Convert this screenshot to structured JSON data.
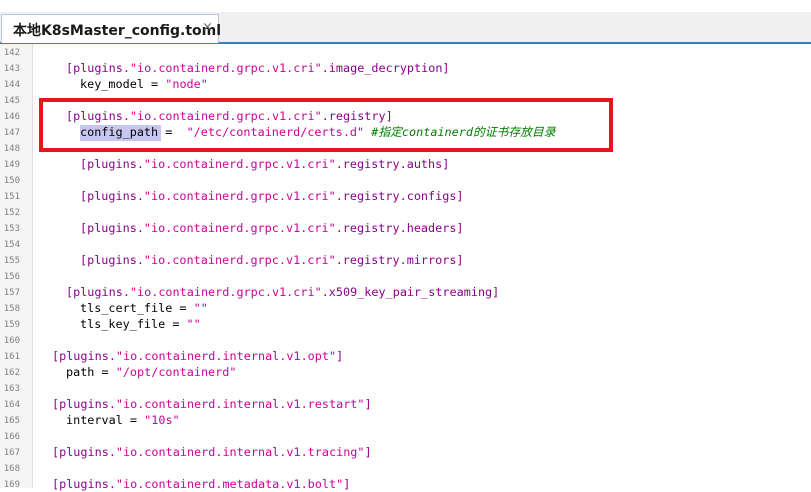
{
  "tab": {
    "title": "本地K8sMaster_config.toml",
    "close": "×"
  },
  "lines": [
    {
      "n": "142",
      "key": "",
      "section": [],
      "tail": ""
    },
    {
      "n": "143",
      "section": [
        "[plugins.",
        "\"io.containerd.grpc.v1.cri\"",
        ".image_decryption]"
      ]
    },
    {
      "n": "144",
      "kv": [
        "key_model = ",
        "\"node\""
      ]
    },
    {
      "n": "145"
    },
    {
      "n": "146",
      "section": [
        "[plugins.",
        "\"io.containerd.grpc.v1.cri\"",
        ".registry]"
      ]
    },
    {
      "n": "147",
      "kv": [
        "config_path",
        " =  ",
        "\"/etc/containerd/certs.d\"",
        " #指定containerd的证书存放目录"
      ]
    },
    {
      "n": "148"
    },
    {
      "n": "149",
      "section": [
        "[plugins.",
        "\"io.containerd.grpc.v1.cri\"",
        ".registry.auths]"
      ]
    },
    {
      "n": "150"
    },
    {
      "n": "151",
      "section": [
        "[plugins.",
        "\"io.containerd.grpc.v1.cri\"",
        ".registry.configs]"
      ]
    },
    {
      "n": "152"
    },
    {
      "n": "153",
      "section": [
        "[plugins.",
        "\"io.containerd.grpc.v1.cri\"",
        ".registry.headers]"
      ]
    },
    {
      "n": "154"
    },
    {
      "n": "155",
      "section": [
        "[plugins.",
        "\"io.containerd.grpc.v1.cri\"",
        ".registry.mirrors]"
      ]
    },
    {
      "n": "156"
    },
    {
      "n": "157",
      "section": [
        "[plugins.",
        "\"io.containerd.grpc.v1.cri\"",
        ".x509_key_pair_streaming]"
      ]
    },
    {
      "n": "158",
      "kv": [
        "tls_cert_file = ",
        "\"\""
      ]
    },
    {
      "n": "159",
      "kv": [
        "tls_key_file = ",
        "\"\""
      ]
    },
    {
      "n": "160"
    },
    {
      "n": "161",
      "section": [
        "[plugins.",
        "\"io.containerd.internal.v1.opt\"",
        "]"
      ]
    },
    {
      "n": "162",
      "kv": [
        "path = ",
        "\"/opt/containerd\""
      ]
    },
    {
      "n": "163"
    },
    {
      "n": "164",
      "section": [
        "[plugins.",
        "\"io.containerd.internal.v1.restart\"",
        "]"
      ]
    },
    {
      "n": "165",
      "kv": [
        "interval = ",
        "\"10s\""
      ]
    },
    {
      "n": "166"
    },
    {
      "n": "167",
      "section": [
        "[plugins.",
        "\"io.containerd.internal.v1.tracing\"",
        "]"
      ]
    },
    {
      "n": "168"
    },
    {
      "n": "169",
      "section": [
        "[plugins.",
        "\"io.containerd.metadata.v1.bolt\"",
        "]"
      ]
    }
  ],
  "colors": {
    "accent_box": "#e8141c",
    "bracket": "#8b008b",
    "string": "#d0009a",
    "comment": "#008000",
    "selection": "#c6c6f0"
  }
}
